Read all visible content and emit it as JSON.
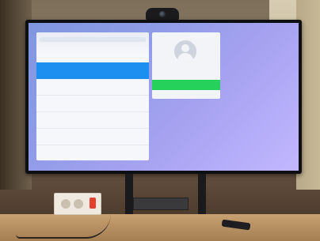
{
  "scene": {
    "description_colors": {
      "screen_accent": "#1c8ff0",
      "call_button": "#25d15a"
    }
  },
  "tv_ui": {
    "left_panel": {
      "title": "",
      "search_placeholder": "",
      "tabs": [
        "",
        "",
        ""
      ],
      "section_label": "",
      "rows": [
        {
          "name": "",
          "meta1": "",
          "meta2": "",
          "selected": true
        },
        {
          "name": "",
          "meta1": "",
          "meta2": "",
          "selected": false
        },
        {
          "name": "",
          "meta1": "",
          "meta2": "",
          "selected": false
        },
        {
          "name": "",
          "meta1": "",
          "meta2": "",
          "selected": false
        },
        {
          "name": "",
          "meta1": "",
          "meta2": "",
          "selected": false
        }
      ]
    },
    "right_panel": {
      "contact_name": "",
      "call_button_label": "",
      "footer_text": ""
    },
    "icons": {
      "avatar": "user-avatar-icon"
    }
  }
}
